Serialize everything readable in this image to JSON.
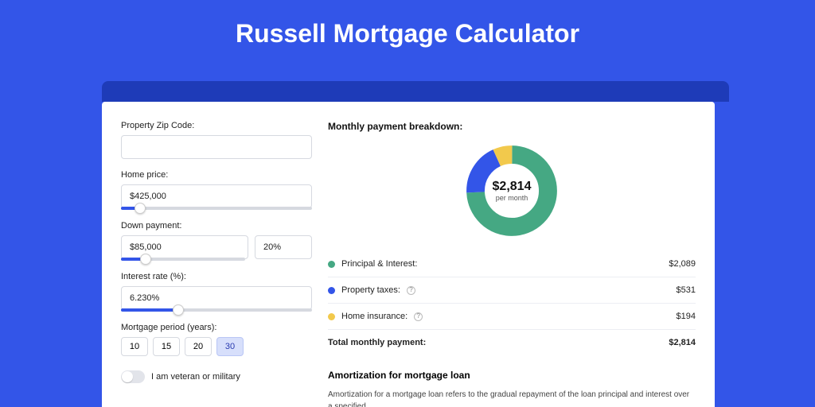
{
  "header": {
    "title": "Russell Mortgage Calculator"
  },
  "form": {
    "zip_label": "Property Zip Code:",
    "zip_value": "",
    "home_price_label": "Home price:",
    "home_price_value": "$425,000",
    "home_price_slider_pct": 10,
    "down_payment_label": "Down payment:",
    "down_payment_value": "$85,000",
    "down_payment_pct_value": "20%",
    "down_payment_slider_pct": 20,
    "interest_label": "Interest rate (%):",
    "interest_value": "6.230%",
    "interest_slider_pct": 30,
    "period_label": "Mortgage period (years):",
    "periods": [
      "10",
      "15",
      "20",
      "30"
    ],
    "period_active_index": 3,
    "veteran_label": "I am veteran or military",
    "veteran_on": false
  },
  "breakdown": {
    "title": "Monthly payment breakdown:",
    "center_amount": "$2,814",
    "center_sub": "per month",
    "items": [
      {
        "label": "Principal & Interest:",
        "value": "$2,089",
        "color": "#45a883",
        "has_help": false
      },
      {
        "label": "Property taxes:",
        "value": "$531",
        "color": "#3355e8",
        "has_help": true
      },
      {
        "label": "Home insurance:",
        "value": "$194",
        "color": "#f2c94c",
        "has_help": true
      }
    ],
    "total_label": "Total monthly payment:",
    "total_value": "$2,814"
  },
  "chart_data": {
    "type": "pie",
    "title": "Monthly payment breakdown",
    "series": [
      {
        "name": "Principal & Interest",
        "value": 2089,
        "color": "#45a883"
      },
      {
        "name": "Property taxes",
        "value": 531,
        "color": "#3355e8"
      },
      {
        "name": "Home insurance",
        "value": 194,
        "color": "#f2c94c"
      }
    ],
    "total": 2814,
    "center_label": "$2,814 per month",
    "donut_inner_radius_ratio": 0.62
  },
  "amortization": {
    "title": "Amortization for mortgage loan",
    "text": "Amortization for a mortgage loan refers to the gradual repayment of the loan principal and interest over a specified"
  }
}
